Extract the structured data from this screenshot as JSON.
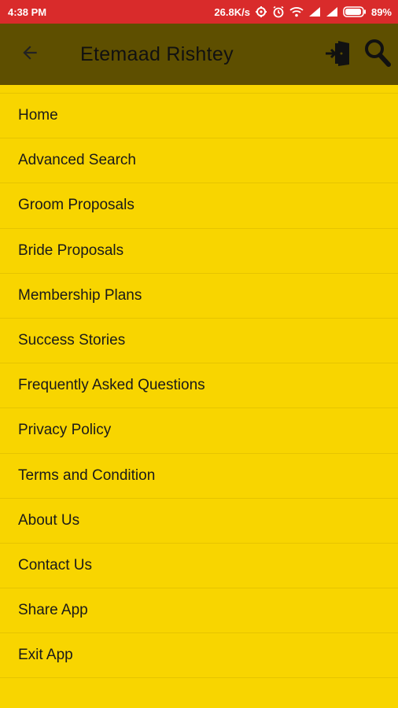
{
  "status_bar": {
    "time": "4:38 PM",
    "speed": "26.8K/s",
    "battery": "89%",
    "icons": [
      "settings-gear-icon",
      "alarm-icon",
      "wifi-icon",
      "signal-icon",
      "signal-icon",
      "battery-icon"
    ]
  },
  "app_bar": {
    "title": "Etemaad Rishtey",
    "back_icon": "arrow-back-icon",
    "actions": [
      "login-door-icon",
      "search-icon"
    ]
  },
  "menu": {
    "items": [
      {
        "label": "Home"
      },
      {
        "label": "Advanced Search"
      },
      {
        "label": "Groom Proposals"
      },
      {
        "label": "Bride Proposals"
      },
      {
        "label": "Membership Plans"
      },
      {
        "label": "Success Stories"
      },
      {
        "label": "Frequently Asked Questions"
      },
      {
        "label": "Privacy Policy"
      },
      {
        "label": "Terms and Condition"
      },
      {
        "label": "About Us"
      },
      {
        "label": "Contact Us"
      },
      {
        "label": "Share App"
      },
      {
        "label": "Exit App"
      }
    ]
  },
  "colors": {
    "status_bar": "#D92B2B",
    "app_bar": "#5E4F00",
    "background": "#F8D500",
    "divider": "#E6C400"
  }
}
